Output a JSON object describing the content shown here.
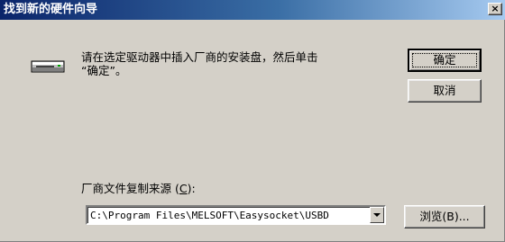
{
  "window": {
    "title": "找到新的硬件向导",
    "close_label": "×"
  },
  "message": "请在选定驱动器中插入厂商的安装盘，然后单击\n“确定”。",
  "buttons": {
    "ok": "确定",
    "cancel": "取消",
    "browse": "浏览(B)..."
  },
  "source": {
    "label_prefix": "厂商文件复制来源 (",
    "label_key": "C",
    "label_suffix": "):",
    "value": "C:\\Program Files\\MELSOFT\\Easysocket\\USBD"
  },
  "icons": {
    "drive": "drive-icon",
    "dropdown": "chevron-down-icon",
    "close": "close-icon"
  },
  "colors": {
    "titlebar_start": "#0a246a",
    "titlebar_end": "#a6caf0",
    "face": "#d4d0c8"
  }
}
